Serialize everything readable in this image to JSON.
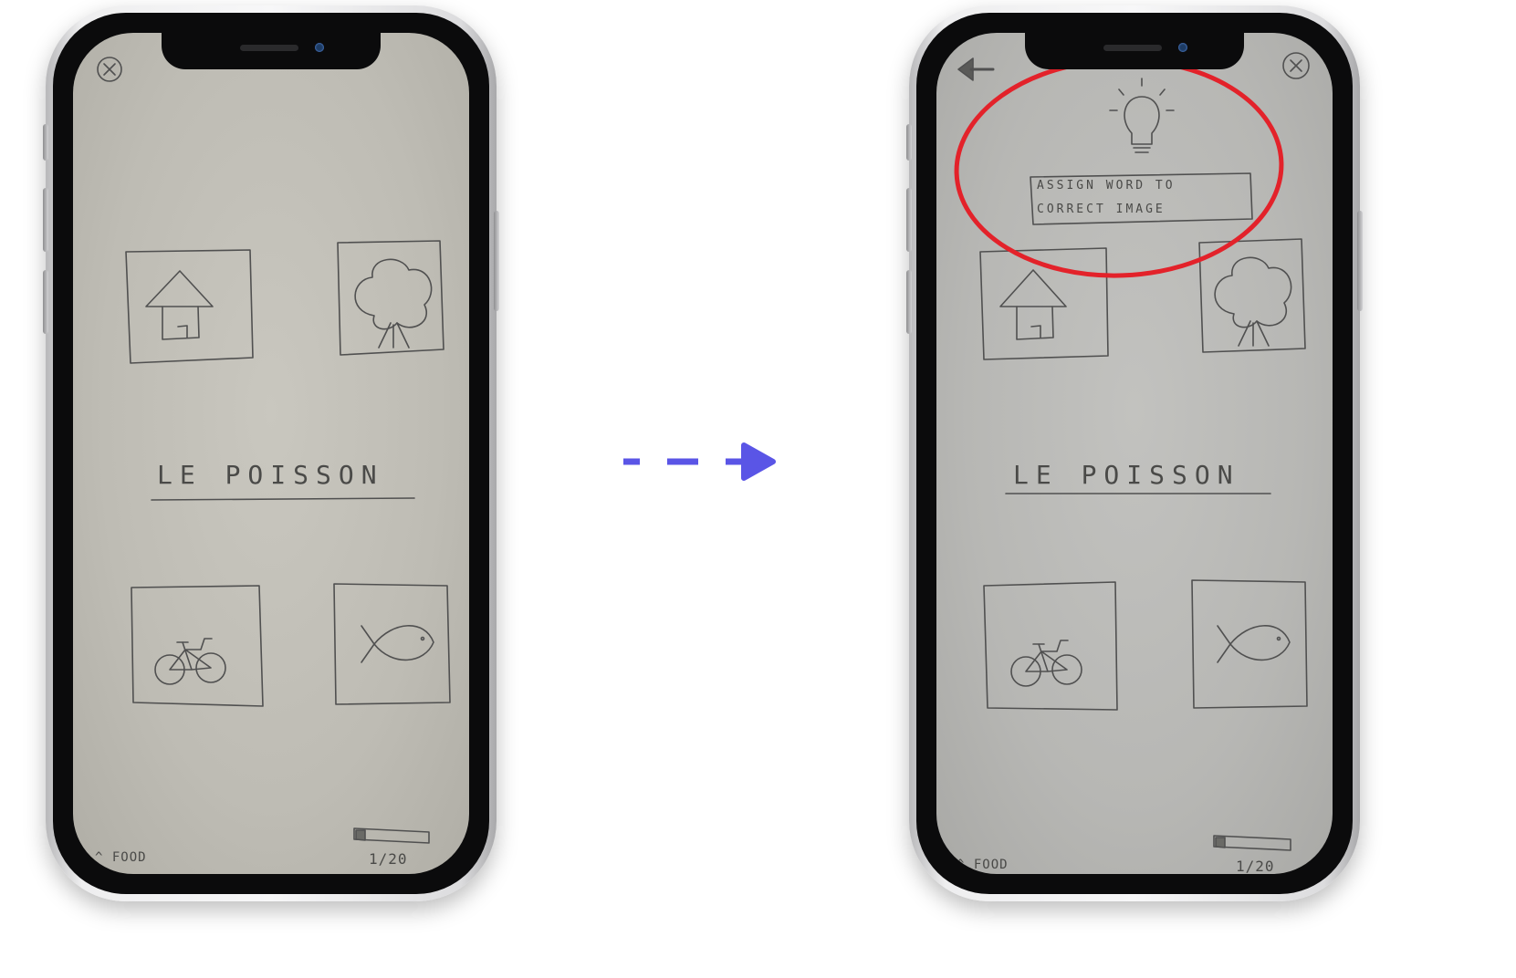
{
  "before_screen": {
    "close_glyph": "✕",
    "word": "LE POISSON",
    "category_arrow": "^",
    "category": "FOOD",
    "progress": "1/20"
  },
  "after_screen": {
    "close_glyph": "✕",
    "tip_text_line1": "ASSIGN WORD TO",
    "tip_text_line2": "CORRECT IMAGE",
    "word": "LE POISSON",
    "category_arrow": "^",
    "category": "FOOD",
    "progress": "1/20"
  },
  "colors": {
    "arrow": "#5a55e6",
    "highlight_ring": "#e3222a",
    "pencil": "#4a4a48"
  },
  "icons": [
    "close-icon",
    "back-arrow-icon",
    "lightbulb-icon",
    "house-icon",
    "tree-icon",
    "bicycle-icon",
    "fish-icon",
    "progress-bar-icon"
  ]
}
